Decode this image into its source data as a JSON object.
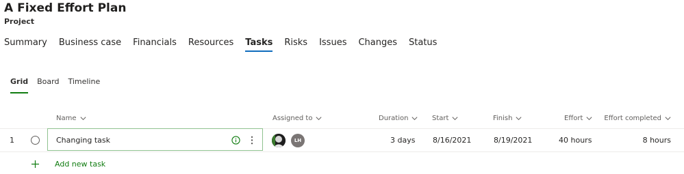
{
  "project": {
    "title": "A Fixed Effort Plan",
    "type": "Project"
  },
  "tabs": [
    {
      "label": "Summary"
    },
    {
      "label": "Business case"
    },
    {
      "label": "Financials"
    },
    {
      "label": "Resources"
    },
    {
      "label": "Tasks"
    },
    {
      "label": "Risks"
    },
    {
      "label": "Issues"
    },
    {
      "label": "Changes"
    },
    {
      "label": "Status"
    }
  ],
  "active_tab": "Tasks",
  "view_tabs": [
    {
      "label": "Grid"
    },
    {
      "label": "Board"
    },
    {
      "label": "Timeline"
    }
  ],
  "active_view": "Grid",
  "columns": {
    "name": "Name",
    "assigned": "Assigned to",
    "duration": "Duration",
    "start": "Start",
    "finish": "Finish",
    "effort": "Effort",
    "effort_completed": "Effort completed"
  },
  "rows": [
    {
      "index": "1",
      "name": "Changing task",
      "assignee_initials": "LH",
      "duration": "3 days",
      "start": "8/16/2021",
      "finish": "8/19/2021",
      "effort": "40 hours",
      "effort_completed": "8 hours"
    }
  ],
  "add_task_label": "Add new task",
  "colors": {
    "accent_blue": "#0f6cbd",
    "accent_green": "#107c10",
    "info_green": "#107c10"
  },
  "icons": [
    "chevron-down-icon",
    "status-circle-icon",
    "info-icon",
    "more-vertical-icon",
    "plus-icon"
  ]
}
